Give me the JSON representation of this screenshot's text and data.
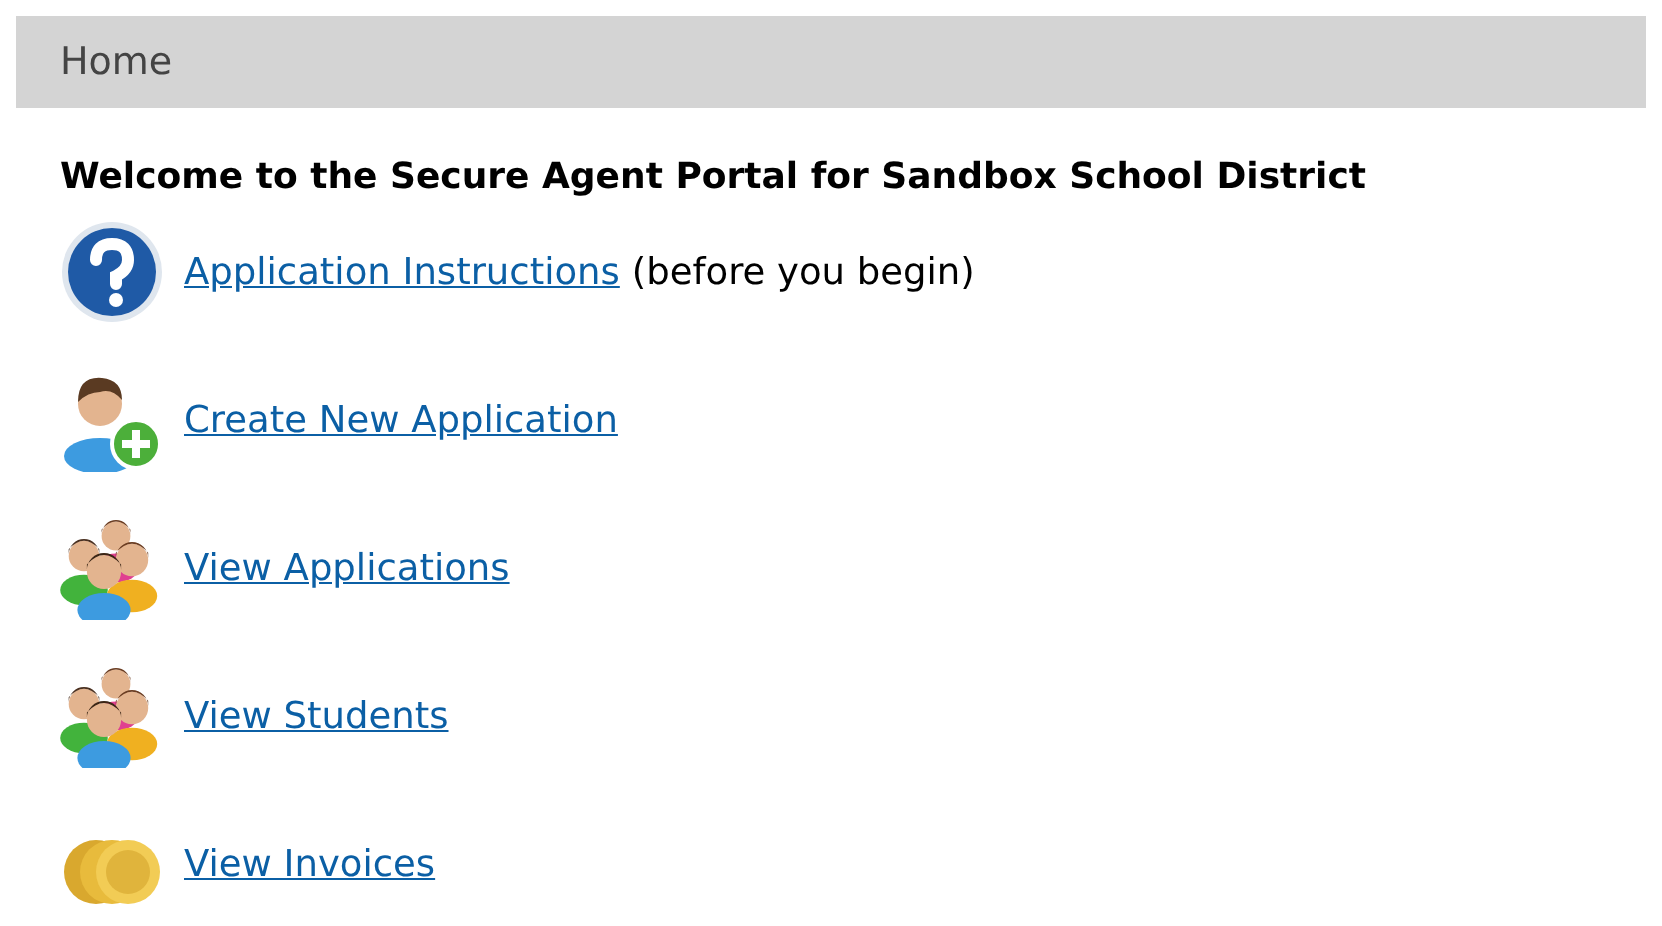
{
  "header": {
    "title": "Home"
  },
  "heading": "Welcome to the Secure Agent Portal for Sandbox School District",
  "links": [
    {
      "kind": "help",
      "label": "Application Instructions",
      "note": "(before you begin)"
    },
    {
      "kind": "add-person",
      "label": "Create New Application"
    },
    {
      "kind": "group",
      "label": "View Applications"
    },
    {
      "kind": "group",
      "label": "View Students"
    },
    {
      "kind": "coins",
      "label": "View Invoices"
    }
  ]
}
